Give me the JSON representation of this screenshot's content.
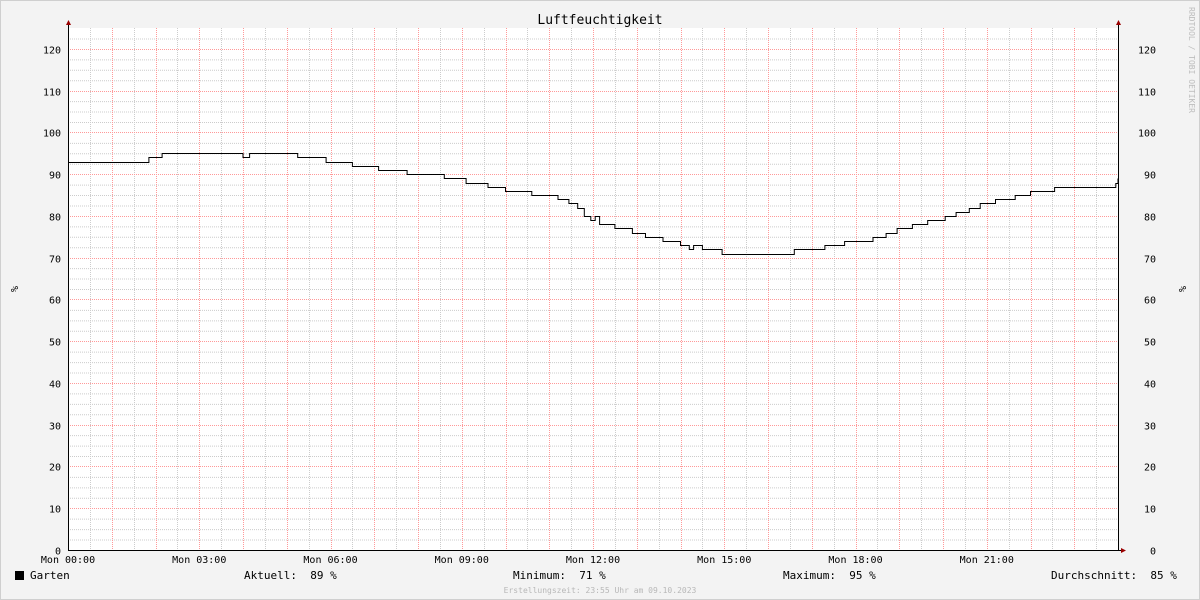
{
  "chart_data": {
    "type": "line",
    "title": "Luftfeuchtigkeit",
    "ylabel": "%",
    "ylim": [
      0,
      125
    ],
    "yticks": [
      0,
      10,
      20,
      30,
      40,
      50,
      60,
      70,
      80,
      90,
      100,
      110,
      120
    ],
    "xlim_hours": [
      0,
      24
    ],
    "xtick_labels": [
      "Mon 00:00",
      "Mon 03:00",
      "Mon 06:00",
      "Mon 09:00",
      "Mon 12:00",
      "Mon 15:00",
      "Mon 18:00",
      "Mon 21:00"
    ],
    "grid": true,
    "colors": {
      "line": "#000000",
      "major_grid": "#ff9999",
      "minor_grid": "#cccccc",
      "arrow": "#990000"
    },
    "series": [
      {
        "name": "Garten",
        "x": [
          0,
          1.85,
          2.15,
          2.55,
          4.0,
          4.15,
          4.3,
          5.25,
          5.9,
          6.5,
          7.1,
          7.75,
          8.6,
          9.1,
          9.6,
          10.0,
          10.6,
          11.2,
          11.45,
          11.65,
          11.8,
          11.95,
          12.05,
          12.15,
          12.5,
          12.9,
          13.2,
          13.6,
          14.0,
          14.2,
          14.3,
          14.5,
          14.95,
          16.6,
          17.3,
          17.75,
          18.4,
          18.7,
          18.95,
          19.3,
          19.65,
          20.05,
          20.3,
          20.6,
          20.85,
          21.2,
          21.65,
          22.0,
          22.55,
          23.95,
          24.0
        ],
        "y": [
          93,
          94,
          95,
          95,
          94,
          95,
          95,
          94,
          93,
          92,
          91,
          90,
          89,
          88,
          87,
          86,
          85,
          84,
          83,
          82,
          80,
          79,
          80,
          78,
          77,
          76,
          75,
          74,
          73,
          72,
          73,
          72,
          71,
          72,
          73,
          74,
          75,
          76,
          77,
          78,
          79,
          80,
          81,
          82,
          83,
          84,
          85,
          86,
          87,
          88,
          89
        ]
      }
    ]
  },
  "legend": {
    "series_name": "Garten",
    "aktuell_label": "Aktuell:",
    "aktuell_value": "89 %",
    "minimum_label": "Minimum:",
    "minimum_value": "71 %",
    "maximum_label": "Maximum:",
    "maximum_value": "95 %",
    "avg_label": "Durchschnitt:",
    "avg_value": "85 %"
  },
  "footer": "Erstellungszeit: 23:55 Uhr am 09.10.2023",
  "watermark": "RRDTOOL / TOBI OETIKER"
}
